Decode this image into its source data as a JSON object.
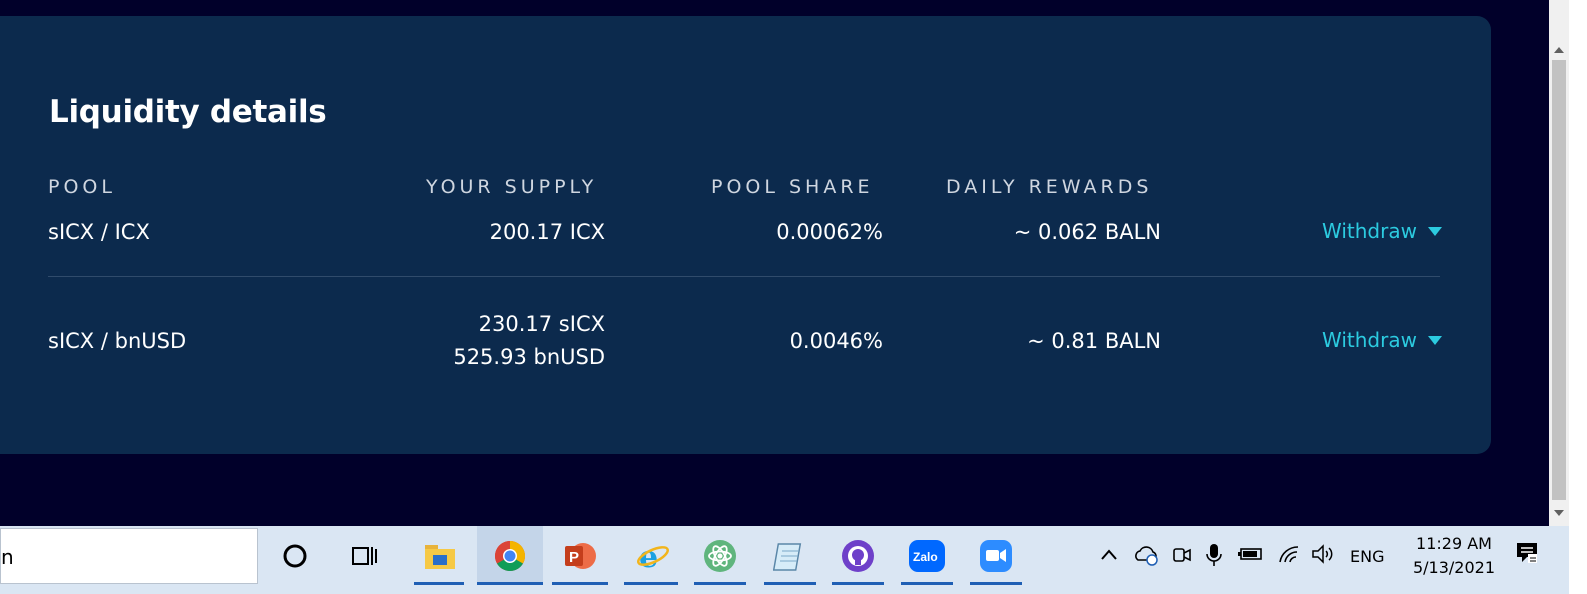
{
  "card": {
    "title": "Liquidity details",
    "headers": {
      "pool": "POOL",
      "supply": "YOUR SUPPLY",
      "share": "POOL SHARE",
      "rewards": "DAILY REWARDS"
    },
    "rows": [
      {
        "pool": "sICX / ICX",
        "supply_line1": "200.17 ICX",
        "supply_line2": "",
        "share": "0.00062%",
        "rewards": "~ 0.062 BALN",
        "action": "Withdraw"
      },
      {
        "pool": "sICX / bnUSD",
        "supply_line1": "230.17 sICX",
        "supply_line2": "525.93 bnUSD",
        "share": "0.0046%",
        "rewards": "~ 0.81 BALN",
        "action": "Withdraw"
      }
    ]
  },
  "colors": {
    "page_bg": "#01002a",
    "card_bg": "#0c2a4d",
    "accent": "#2ccbe0",
    "taskbar_bg": "#dae6f3"
  },
  "taskbar": {
    "search_text": "n",
    "apps": [
      "cortana-icon",
      "task-view-icon",
      "file-explorer-icon",
      "chrome-icon",
      "powerpoint-icon",
      "internet-explorer-icon",
      "atom-icon",
      "notepad-icon",
      "github-desktop-icon",
      "zalo-icon",
      "zoom-icon"
    ],
    "zalo_label": "Zalo",
    "tray": {
      "language": "ENG",
      "time": "11:29 AM",
      "date": "5/13/2021"
    }
  }
}
